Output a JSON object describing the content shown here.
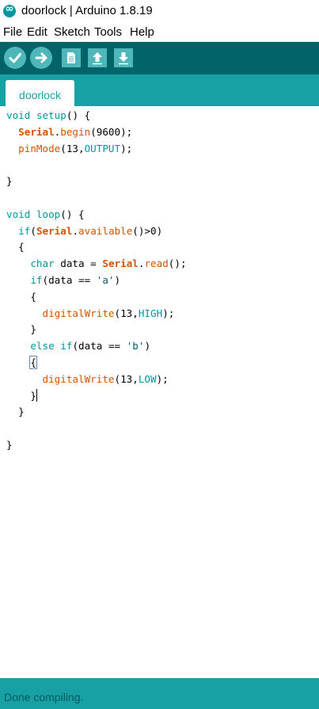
{
  "window": {
    "title": "doorlock | Arduino 1.8.19"
  },
  "menu": [
    "File",
    "Edit",
    "Sketch",
    "Tools",
    "Help"
  ],
  "toolbar": {
    "buttons": [
      {
        "name": "verify-button",
        "icon": "checkmark-icon"
      },
      {
        "name": "upload-button",
        "icon": "arrow-right-icon"
      },
      {
        "name": "new-button",
        "icon": "document-icon"
      },
      {
        "name": "open-button",
        "icon": "arrow-up-icon"
      },
      {
        "name": "save-button",
        "icon": "arrow-down-icon"
      }
    ]
  },
  "tabs": [
    {
      "label": "doorlock"
    }
  ],
  "editor": {
    "lines": [
      "void setup() {",
      "  Serial.begin(9600);",
      "  pinMode(13,OUTPUT);",
      "",
      "}",
      "",
      "void loop() {",
      "  if(Serial.available()>0)",
      "  {",
      "    char data = Serial.read();",
      "    if(data == 'a')",
      "    {",
      "      digitalWrite(13,HIGH);",
      "    }",
      "    else if(data == 'b')",
      "    {",
      "      digitalWrite(13,LOW);",
      "    }",
      "  }",
      "",
      "}"
    ]
  },
  "status": {
    "text": "Done compiling."
  },
  "colors": {
    "toolbar": "#006468",
    "accent": "#17a1a5",
    "button": "#4db7bb",
    "keyword": "#00979c",
    "function": "#d35400"
  }
}
